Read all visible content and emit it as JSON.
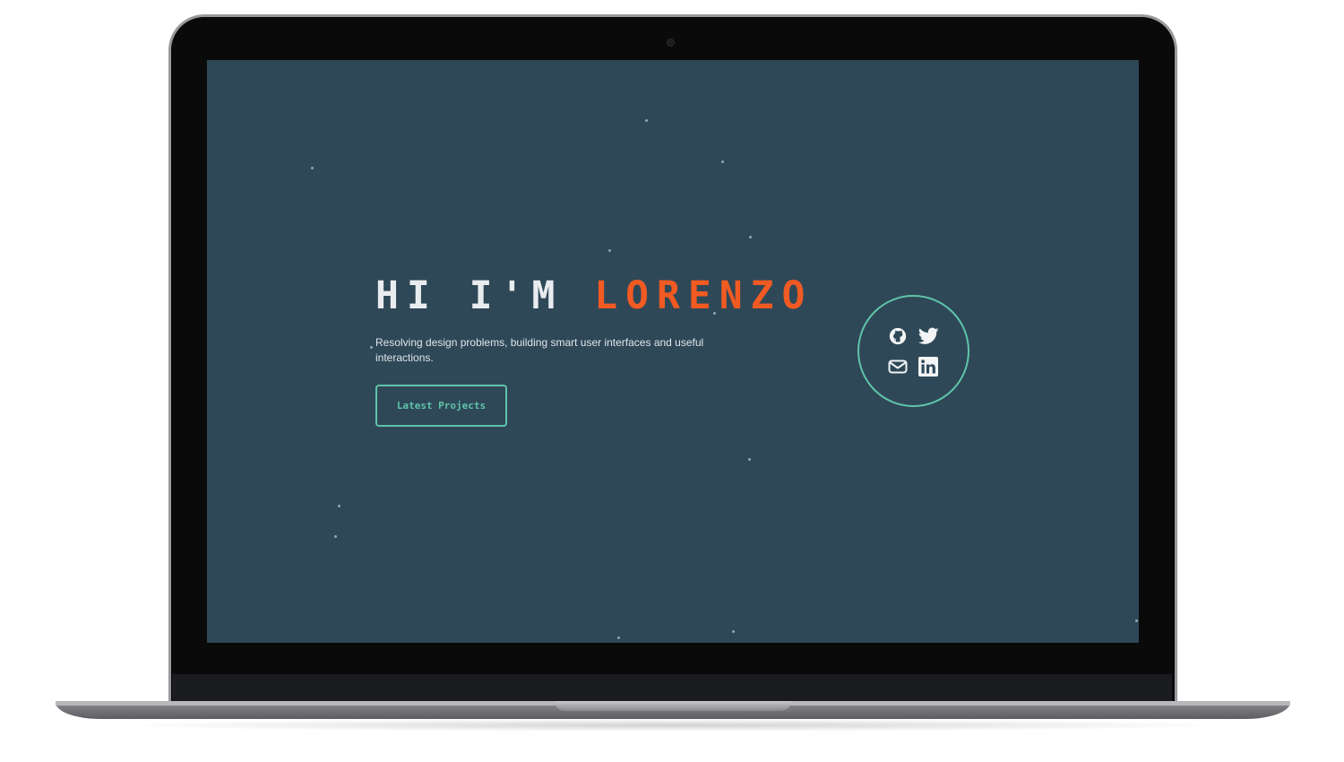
{
  "hero": {
    "greeting": "HI I'M ",
    "name": "LORENZO",
    "subtitle": "Resolving design problems, building smart user interfaces and useful interactions.",
    "cta_label": "Latest Projects"
  },
  "social": {
    "icons": [
      "github-icon",
      "twitter-icon",
      "mail-icon",
      "linkedin-icon"
    ]
  },
  "colors": {
    "background": "#2f4858",
    "accent": "#f15a22",
    "teal": "#5fc4a9",
    "text": "#e9ecef"
  }
}
